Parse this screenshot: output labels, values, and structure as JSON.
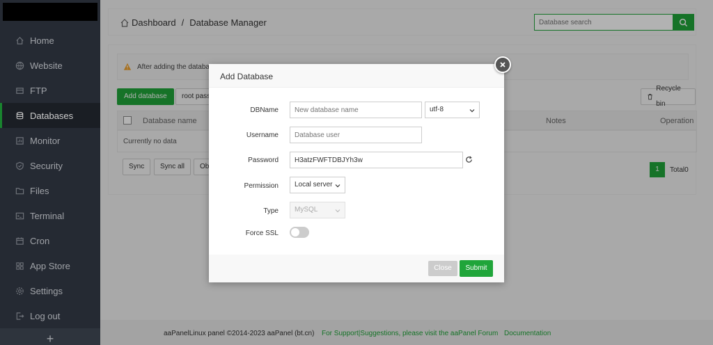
{
  "sidebar": {
    "items": [
      {
        "label": "Home",
        "icon": "home-icon"
      },
      {
        "label": "Website",
        "icon": "globe-icon"
      },
      {
        "label": "FTP",
        "icon": "ftp-icon"
      },
      {
        "label": "Databases",
        "icon": "database-icon"
      },
      {
        "label": "Monitor",
        "icon": "monitor-icon"
      },
      {
        "label": "Security",
        "icon": "shield-icon"
      },
      {
        "label": "Files",
        "icon": "folder-icon"
      },
      {
        "label": "Terminal",
        "icon": "terminal-icon"
      },
      {
        "label": "Cron",
        "icon": "calendar-icon"
      },
      {
        "label": "App Store",
        "icon": "apps-icon"
      },
      {
        "label": "Settings",
        "icon": "gear-icon"
      },
      {
        "label": "Log out",
        "icon": "logout-icon"
      }
    ],
    "plus": "+",
    "active_index": 3
  },
  "header": {
    "crumb_home": "Dashboard",
    "crumb_sep": "/",
    "crumb_current": "Database Manager",
    "search_placeholder": "Database search"
  },
  "panel": {
    "alert_text": "After adding the databas",
    "add_button": "Add database",
    "root_button": "root pass",
    "recycle_button": "Recycle bin",
    "columns": {
      "name": "Database name",
      "notes": "Notes",
      "operation": "Operation"
    },
    "empty_text": "Currently no data",
    "sync_button": "Sync",
    "sync_all_button": "Sync all",
    "ob_button": "Ob",
    "page": "1",
    "total": "Total0"
  },
  "modal": {
    "title": "Add Database",
    "dbname": {
      "label": "DBName",
      "placeholder": "New database name",
      "charset": "utf-8"
    },
    "username": {
      "label": "Username",
      "placeholder": "Database user"
    },
    "password": {
      "label": "Password",
      "value": "H3atzFWFTDBJYh3w"
    },
    "permission": {
      "label": "Permission",
      "value": "Local server"
    },
    "type": {
      "label": "Type",
      "value": "MySQL"
    },
    "force_ssl": {
      "label": "Force SSL",
      "enabled": false
    },
    "close_button": "Close",
    "submit_button": "Submit"
  },
  "footer": {
    "copyright": "aaPanelLinux panel ©2014-2023 aaPanel (bt.cn)",
    "support": "For Support|Suggestions, please visit the aaPanel Forum",
    "docs": "Documentation"
  },
  "colors": {
    "accent": "#20a53a",
    "sidebar_bg": "#2f3540"
  }
}
